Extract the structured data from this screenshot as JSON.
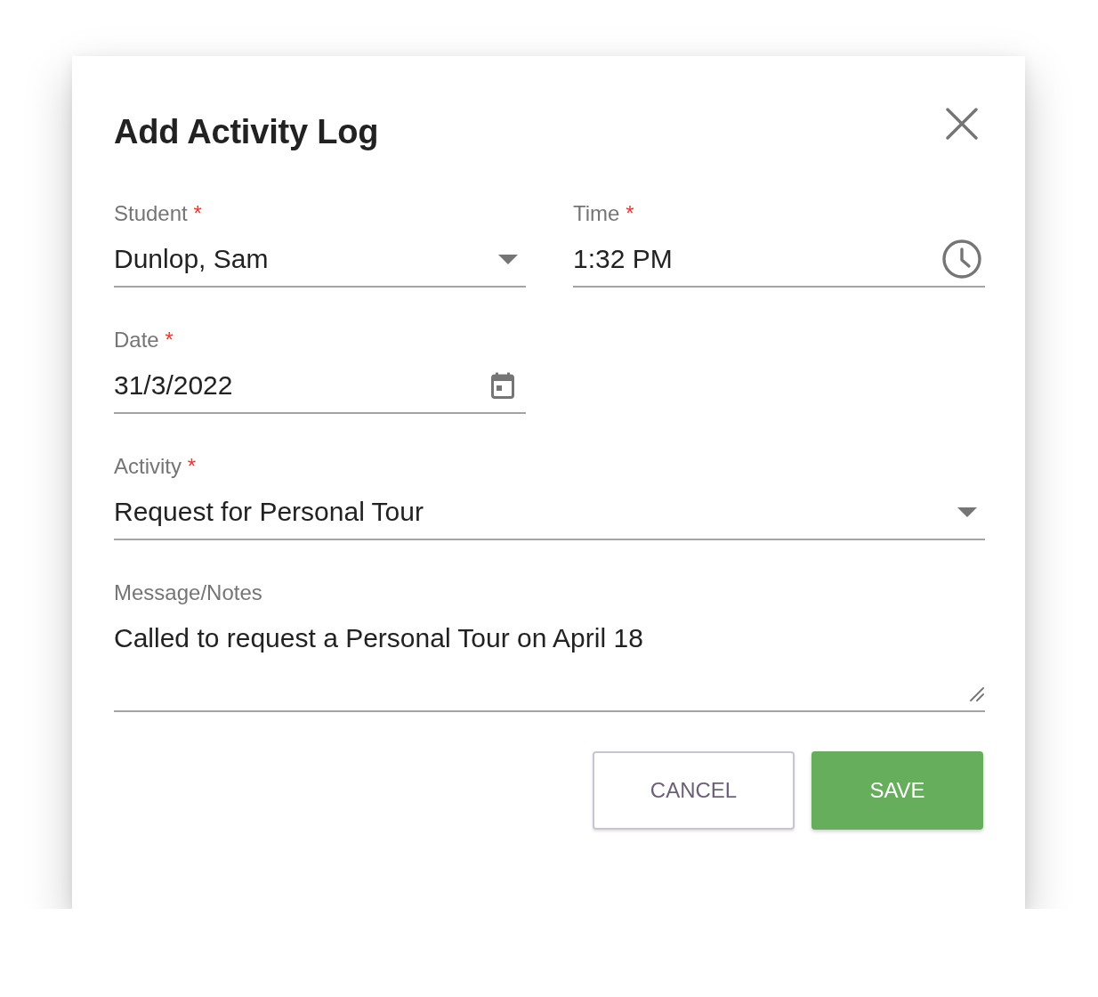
{
  "dialog": {
    "title": "Add Activity Log",
    "rows": [
      {
        "fields": [
          {
            "kind": "select",
            "label": "Student",
            "required_mark": "*",
            "value": "Dunlop, Sam"
          },
          {
            "kind": "time",
            "label": "Time",
            "required_mark": "*",
            "value": "1:32 PM"
          }
        ]
      },
      {
        "fields": [
          {
            "kind": "date",
            "label": "Date",
            "required_mark": "*",
            "value": "31/3/2022"
          }
        ]
      },
      {
        "fields": [
          {
            "kind": "select",
            "label": "Activity",
            "required_mark": "*",
            "value": "Request for Personal Tour"
          }
        ]
      },
      {
        "fields": [
          {
            "kind": "textarea",
            "label": "Message/Notes",
            "value": "Called to request a Personal Tour on April 18"
          }
        ]
      }
    ],
    "buttons": [
      {
        "kind": "outlined",
        "label": "CANCEL"
      },
      {
        "kind": "primary",
        "label": "SAVE"
      }
    ]
  }
}
